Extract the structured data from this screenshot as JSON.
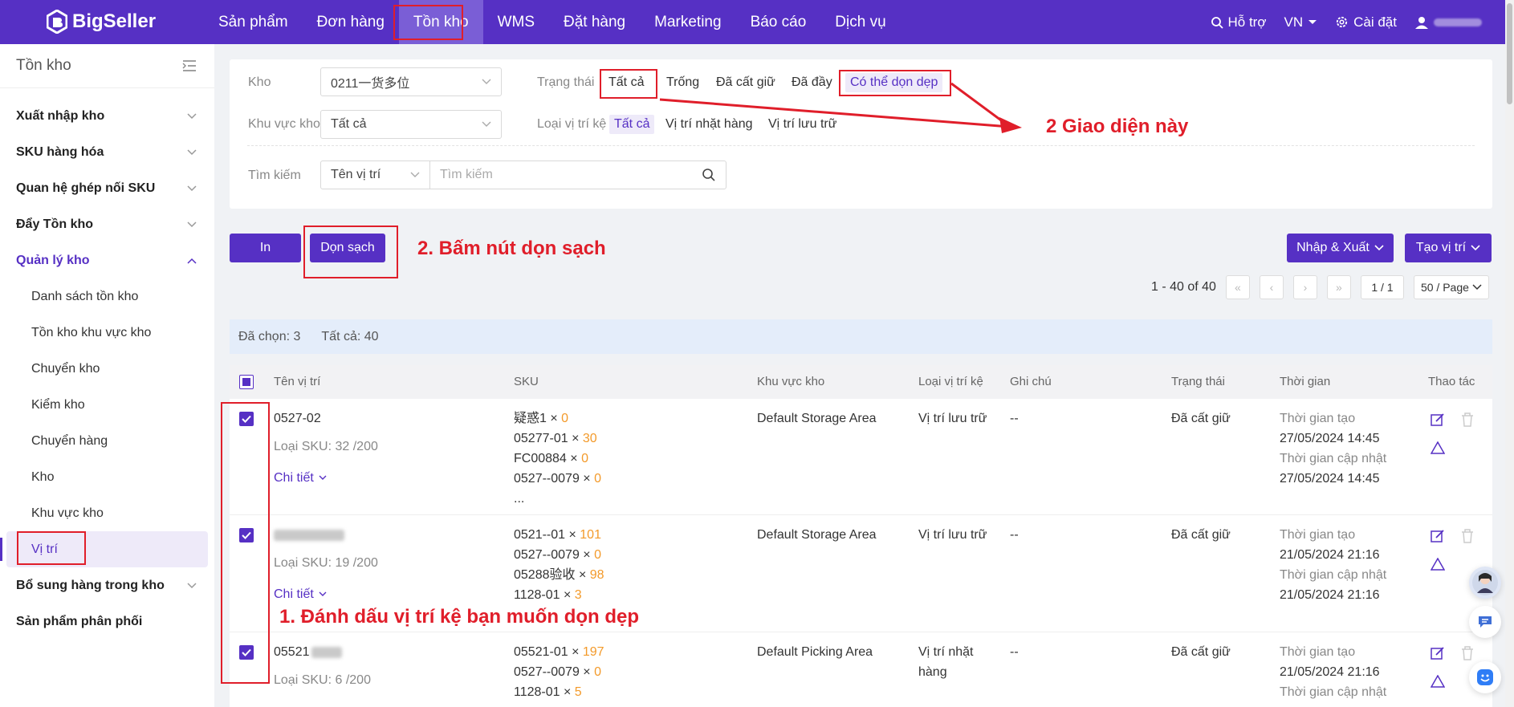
{
  "brand": {
    "name": "BigSeller"
  },
  "nav": {
    "items": [
      "Sản phẩm",
      "Đơn hàng",
      "Tồn kho",
      "WMS",
      "Đặt hàng",
      "Marketing",
      "Báo cáo",
      "Dịch vụ"
    ],
    "help": "Hỗ trợ",
    "lang": "VN",
    "settings": "Cài đặt"
  },
  "sidebar": {
    "title": "Tồn kho",
    "groups": [
      "Xuất nhập kho",
      "SKU hàng hóa",
      "Quan hệ ghép nối SKU",
      "Đẩy Tồn kho",
      "Quản lý kho"
    ],
    "sub_items": [
      "Danh sách tồn kho",
      "Tồn kho khu vực kho",
      "Chuyển kho",
      "Kiểm kho",
      "Chuyển hàng",
      "Kho",
      "Khu vực kho",
      "Vị trí"
    ],
    "groups_after": [
      "Bổ sung hàng trong kho",
      "Sản phẩm phân phối"
    ]
  },
  "filter": {
    "warehouse_label": "Kho",
    "warehouse_value": "0211一货多位",
    "status_label": "Trạng thái",
    "status_options": [
      "Tất cả",
      "Trống",
      "Đã cất giữ",
      "Đã đầy",
      "Có thể dọn dẹp"
    ],
    "zone_label": "Khu vực kho",
    "zone_value": "Tất cả",
    "shelf_type_label": "Loại vị trí kệ",
    "shelf_type_options": [
      "Tất cả",
      "Vị trí nhặt hàng",
      "Vị trí lưu trữ"
    ],
    "search_label": "Tìm kiếm",
    "search_field": "Tên vị trí",
    "search_placeholder": "Tìm kiếm"
  },
  "toolbar": {
    "print": "In",
    "clean": "Dọn sạch",
    "import_export": "Nhập & Xuất",
    "create": "Tạo vị trí"
  },
  "pagination": {
    "range": "1 - 40 of 40",
    "page": "1 / 1",
    "per_page": "50 / Page"
  },
  "selection": {
    "selected": "Đã chọn: 3",
    "total": "Tất cả: 40"
  },
  "table": {
    "headers": [
      "Tên vị trí",
      "SKU",
      "Khu vực kho",
      "Loại vị trí kệ",
      "Ghi chú",
      "Trạng thái",
      "Thời gian",
      "Thao tác"
    ],
    "rows": [
      {
        "name": "0527-02",
        "sku_types": "Loại SKU: 32 /200",
        "detail": "Chi tiết",
        "skus": [
          {
            "code": "疑惑1",
            "qty": "0"
          },
          {
            "code": "05277-01",
            "qty": "30"
          },
          {
            "code": "FC00884",
            "qty": "0"
          },
          {
            "code": "0527--0079",
            "qty": "0"
          }
        ],
        "more": "...",
        "zone": "Default Storage Area",
        "shelf_type": "Vị trí lưu trữ",
        "note": "--",
        "status": "Đã cất giữ",
        "created_label": "Thời gian tạo",
        "created": "27/05/2024 14:45",
        "updated_label": "Thời gian cập nhật",
        "updated": "27/05/2024 14:45"
      },
      {
        "name": "",
        "sku_types": "Loại SKU: 19 /200",
        "detail": "Chi tiết",
        "skus": [
          {
            "code": "0521--01",
            "qty": "101"
          },
          {
            "code": "0527--0079",
            "qty": "0"
          },
          {
            "code": "05288验收",
            "qty": "98"
          },
          {
            "code": "1128-01",
            "qty": "3"
          }
        ],
        "zone": "Default Storage Area",
        "shelf_type": "Vị trí lưu trữ",
        "note": "--",
        "status": "Đã cất giữ",
        "created_label": "Thời gian tạo",
        "created": "21/05/2024 21:16",
        "updated_label": "Thời gian cập nhật",
        "updated": "21/05/2024 21:16"
      },
      {
        "name": "05521",
        "sku_types": "Loại SKU: 6 /200",
        "skus": [
          {
            "code": "05521-01",
            "qty": "197"
          },
          {
            "code": "0527--0079",
            "qty": "0"
          },
          {
            "code": "1128-01",
            "qty": "5"
          }
        ],
        "zone": "Default Picking Area",
        "shelf_type": "Vị trí nhặt hàng",
        "note": "--",
        "status": "Đã cất giữ",
        "created_label": "Thời gian tạo",
        "created": "21/05/2024 21:16",
        "updated_label": "Thời gian cập nhật"
      }
    ]
  },
  "annotations": {
    "step1": "1. Đánh dấu vị trí kệ bạn muốn dọn dẹp",
    "step2": "2. Bấm nút dọn sạch",
    "step3": "2 Giao diện này"
  },
  "colors": {
    "brand": "#5630c4",
    "annotation": "#e01e2a",
    "qty": "#f39a2a"
  }
}
